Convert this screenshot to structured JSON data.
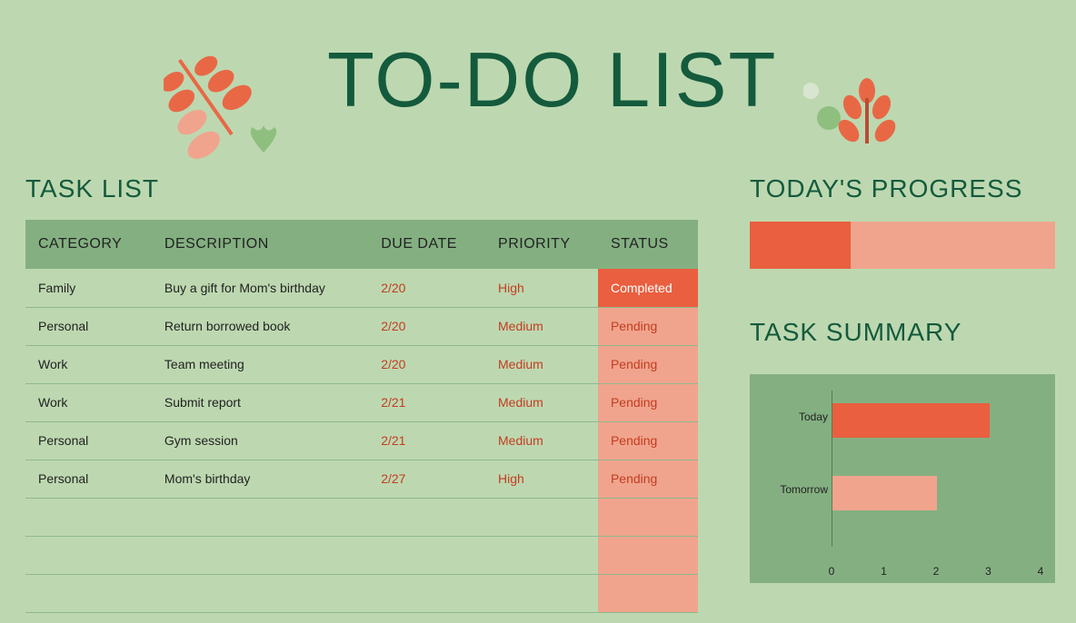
{
  "title": "TO-DO LIST",
  "task_list": {
    "heading": "TASK LIST",
    "columns": [
      "CATEGORY",
      "DESCRIPTION",
      "DUE DATE",
      "PRIORITY",
      "STATUS"
    ],
    "rows": [
      {
        "category": "Family",
        "description": "Buy a gift for Mom's birthday",
        "due": "2/20",
        "priority": "High",
        "status": "Completed"
      },
      {
        "category": "Personal",
        "description": "Return borrowed book",
        "due": "2/20",
        "priority": "Medium",
        "status": "Pending"
      },
      {
        "category": "Work",
        "description": "Team meeting",
        "due": "2/20",
        "priority": "Medium",
        "status": "Pending"
      },
      {
        "category": "Work",
        "description": "Submit report",
        "due": "2/21",
        "priority": "Medium",
        "status": "Pending"
      },
      {
        "category": "Personal",
        "description": "Gym session",
        "due": "2/21",
        "priority": "Medium",
        "status": "Pending"
      },
      {
        "category": "Personal",
        "description": "Mom's birthday",
        "due": "2/27",
        "priority": "High",
        "status": "Pending"
      }
    ],
    "empty_rows": 3
  },
  "progress": {
    "heading": "TODAY'S PROGRESS",
    "percent": 33
  },
  "summary": {
    "heading": "TASK SUMMARY"
  },
  "chart_data": {
    "type": "bar",
    "orientation": "horizontal",
    "categories": [
      "Today",
      "Tomorrow"
    ],
    "values": [
      3,
      2
    ],
    "xlabel": "",
    "ylabel": "",
    "xlim": [
      0,
      4
    ],
    "ticks": [
      0,
      1,
      2,
      3,
      4
    ],
    "colors": [
      "#e95f3f",
      "#f0a48d"
    ]
  }
}
